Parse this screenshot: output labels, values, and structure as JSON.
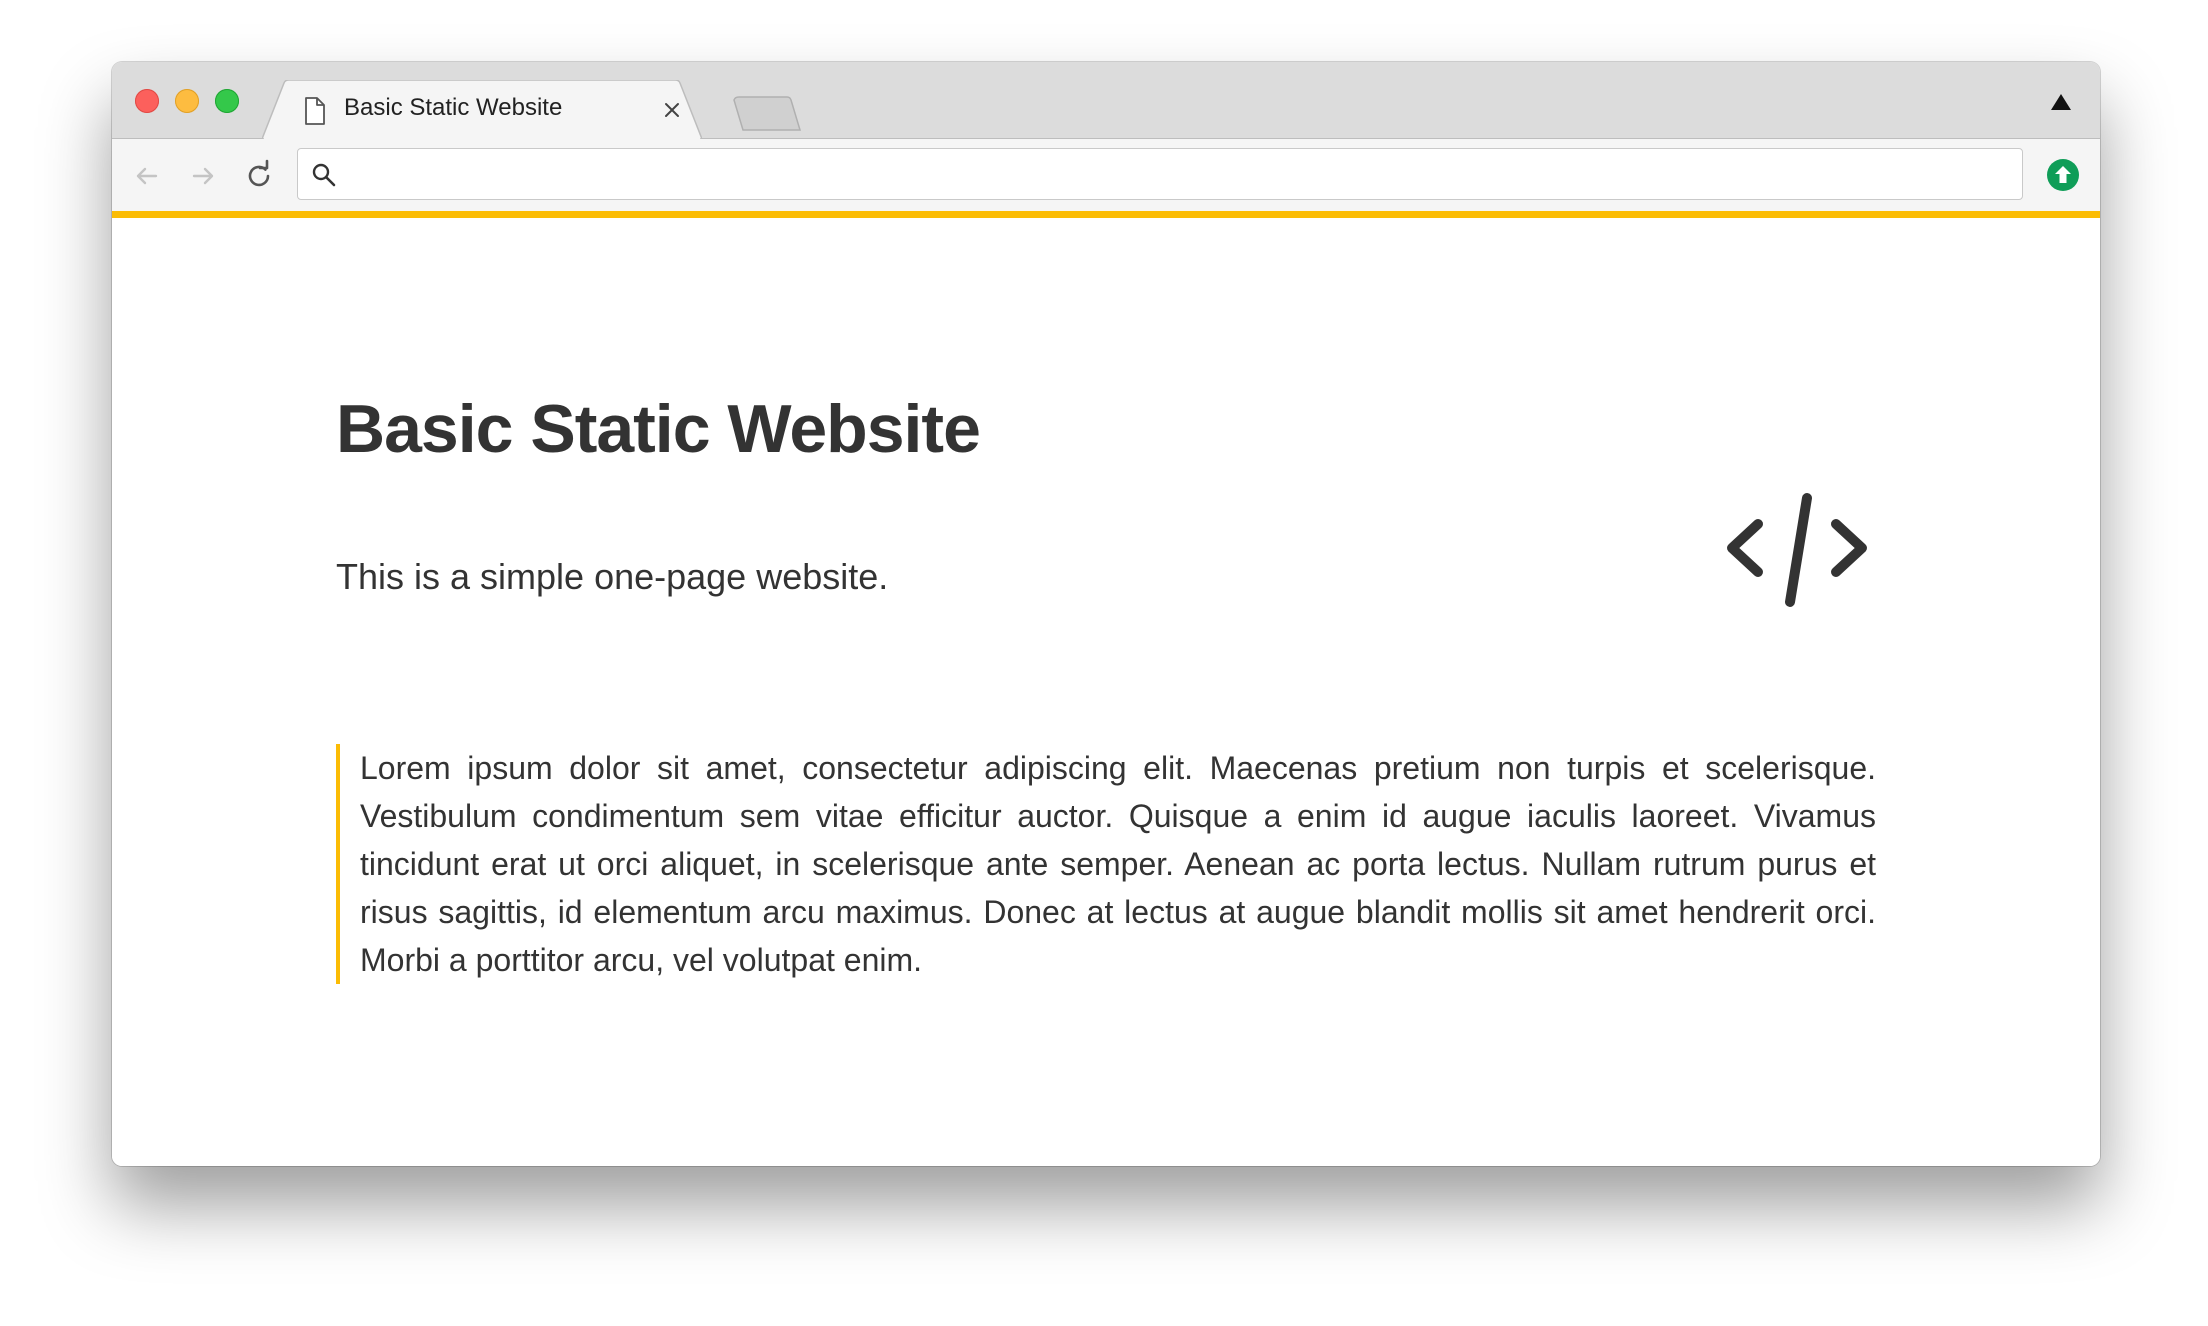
{
  "browser": {
    "tab": {
      "title": "Basic Static Website"
    },
    "omnibox": {
      "value": "",
      "placeholder": ""
    },
    "accent_color": "#fbbc05",
    "update_badge_color": "#0f9d58"
  },
  "page": {
    "title": "Basic Static Website",
    "subtitle": "This is a simple one-page website.",
    "icon": "code-icon",
    "blockquote": "Lorem ipsum dolor sit amet, consectetur adipiscing elit. Maecenas pretium non turpis et scelerisque. Vestibulum condimentum sem vitae efficitur auctor. Quisque a enim id augue iaculis laoreet. Vivamus tincidunt erat ut orci aliquet, in scelerisque ante semper. Aenean ac porta lectus. Nullam rutrum purus et risus sagittis, id elementum arcu maximus. Donec at lectus at augue blandit mollis sit amet hendrerit orci. Morbi a porttitor arcu, vel volutpat enim."
  }
}
